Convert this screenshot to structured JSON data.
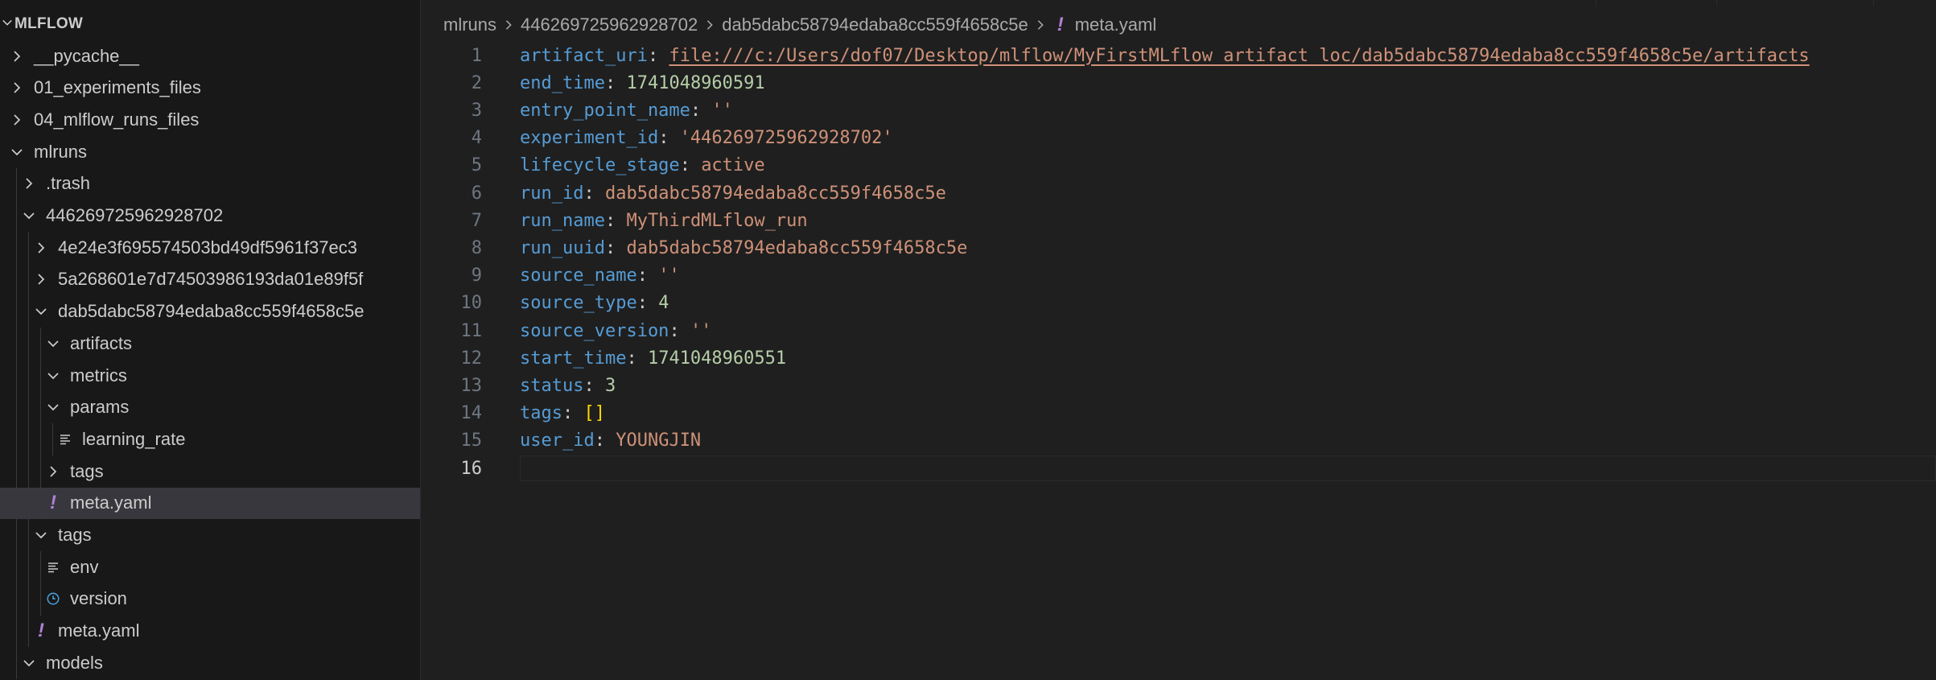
{
  "explorer": {
    "root_label": "MLFLOW",
    "items": [
      {
        "label": "__pycache__",
        "kind": "folder",
        "expanded": false,
        "depth": 0
      },
      {
        "label": "01_experiments_files",
        "kind": "folder",
        "expanded": false,
        "depth": 0
      },
      {
        "label": "04_mlflow_runs_files",
        "kind": "folder",
        "expanded": false,
        "depth": 0
      },
      {
        "label": "mlruns",
        "kind": "folder",
        "expanded": true,
        "depth": 0
      },
      {
        "label": ".trash",
        "kind": "folder",
        "expanded": false,
        "depth": 1
      },
      {
        "label": "446269725962928702",
        "kind": "folder",
        "expanded": true,
        "depth": 1
      },
      {
        "label": "4e24e3f695574503bd49df5961f37ec3",
        "kind": "folder",
        "expanded": false,
        "depth": 2
      },
      {
        "label": "5a268601e7d74503986193da01e89f5f",
        "kind": "folder",
        "expanded": false,
        "depth": 2
      },
      {
        "label": "dab5dabc58794edaba8cc559f4658c5e",
        "kind": "folder",
        "expanded": true,
        "depth": 2
      },
      {
        "label": "artifacts",
        "kind": "folder",
        "expanded": true,
        "depth": 3
      },
      {
        "label": "metrics",
        "kind": "folder",
        "expanded": true,
        "depth": 3
      },
      {
        "label": "params",
        "kind": "folder",
        "expanded": true,
        "depth": 3
      },
      {
        "label": "learning_rate",
        "kind": "file-lines",
        "depth": 4
      },
      {
        "label": "tags",
        "kind": "folder",
        "expanded": false,
        "depth": 3
      },
      {
        "label": "meta.yaml",
        "kind": "yaml",
        "depth": 3,
        "selected": true
      },
      {
        "label": "tags",
        "kind": "folder",
        "expanded": true,
        "depth": 2
      },
      {
        "label": "env",
        "kind": "file-lines",
        "depth": 3
      },
      {
        "label": "version",
        "kind": "clock",
        "depth": 3
      },
      {
        "label": "meta.yaml",
        "kind": "yaml",
        "depth": 2
      },
      {
        "label": "models",
        "kind": "folder",
        "expanded": true,
        "depth": 1
      }
    ]
  },
  "breadcrumb": {
    "parts": [
      "mlruns",
      "446269725962928702",
      "dab5dabc58794edaba8cc559f4658c5e"
    ],
    "file": "meta.yaml",
    "file_icon": "yaml-exclamation-icon"
  },
  "editor": {
    "active_line": 16,
    "lines": [
      {
        "n": "1",
        "key": "artifact_uri",
        "value": "file:///c:/Users/dof07/Desktop/mlflow/MyFirstMLflow_artifact_loc/dab5dabc58794edaba8cc559f4658c5e/artifacts",
        "type": "link"
      },
      {
        "n": "2",
        "key": "end_time",
        "value": "1741048960591",
        "type": "num"
      },
      {
        "n": "3",
        "key": "entry_point_name",
        "value": "''",
        "type": "str"
      },
      {
        "n": "4",
        "key": "experiment_id",
        "value": "'446269725962928702'",
        "type": "str"
      },
      {
        "n": "5",
        "key": "lifecycle_stage",
        "value": "active",
        "type": "str"
      },
      {
        "n": "6",
        "key": "run_id",
        "value": "dab5dabc58794edaba8cc559f4658c5e",
        "type": "str"
      },
      {
        "n": "7",
        "key": "run_name",
        "value": "MyThirdMLflow_run",
        "type": "str"
      },
      {
        "n": "8",
        "key": "run_uuid",
        "value": "dab5dabc58794edaba8cc559f4658c5e",
        "type": "str"
      },
      {
        "n": "9",
        "key": "source_name",
        "value": "''",
        "type": "str"
      },
      {
        "n": "10",
        "key": "source_type",
        "value": "4",
        "type": "num"
      },
      {
        "n": "11",
        "key": "source_version",
        "value": "''",
        "type": "str"
      },
      {
        "n": "12",
        "key": "start_time",
        "value": "1741048960551",
        "type": "num"
      },
      {
        "n": "13",
        "key": "status",
        "value": "3",
        "type": "num"
      },
      {
        "n": "14",
        "key": "tags",
        "value": "[]",
        "type": "bracket"
      },
      {
        "n": "15",
        "key": "user_id",
        "value": "YOUNGJIN",
        "type": "str"
      },
      {
        "n": "16",
        "key": "",
        "value": "",
        "type": "empty"
      }
    ]
  },
  "colors": {
    "key": "#569cd6",
    "string": "#ce9178",
    "number": "#b5cea8",
    "bracket": "#ffd700",
    "yaml_icon": "#b180d7",
    "clock_icon": "#4aa3df"
  }
}
